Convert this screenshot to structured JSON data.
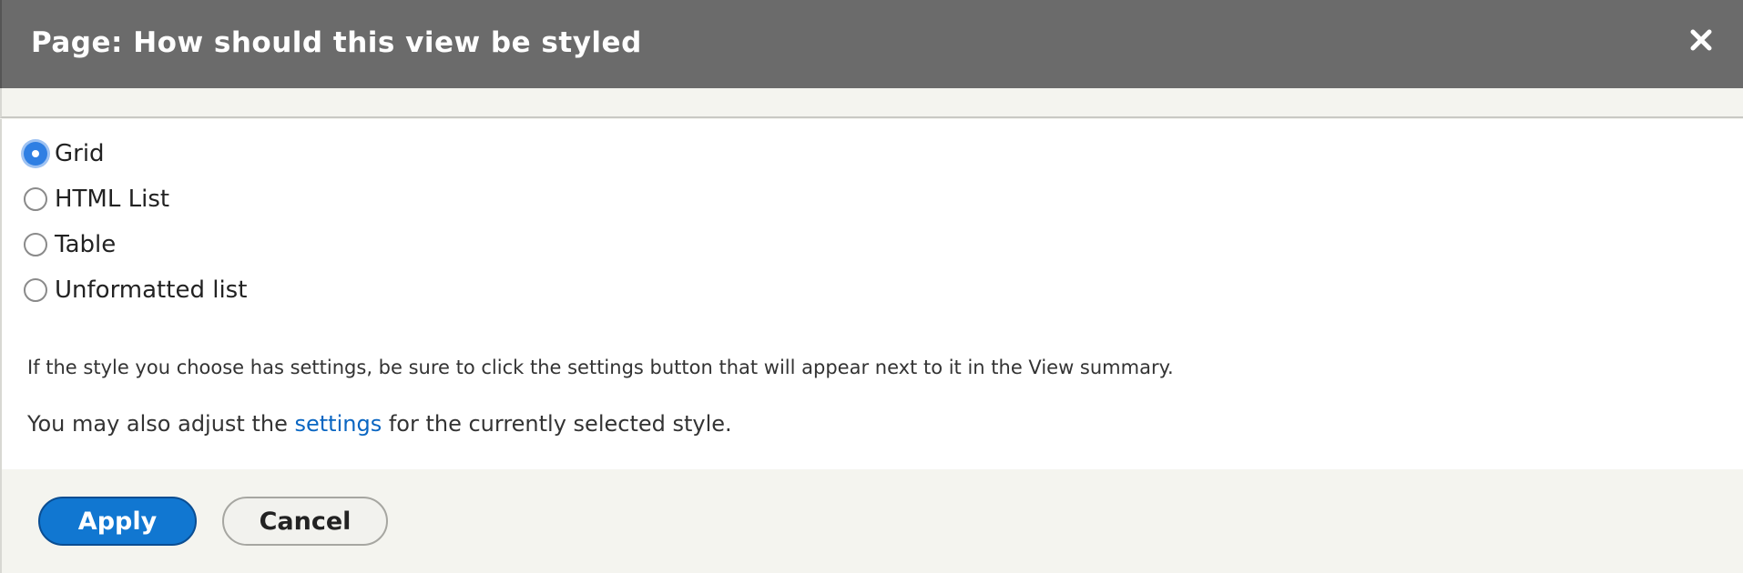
{
  "dialog": {
    "title": "Page: How should this view be styled",
    "close_icon": "close-icon"
  },
  "style_options": {
    "selected": "Grid",
    "items": [
      {
        "label": "Grid",
        "checked": true
      },
      {
        "label": "HTML List",
        "checked": false
      },
      {
        "label": "Table",
        "checked": false
      },
      {
        "label": "Unformatted list",
        "checked": false
      }
    ]
  },
  "help_text": "If the style you choose has settings, be sure to click the settings button that will appear next to it in the View summary.",
  "adjust": {
    "prefix": "You may also adjust the ",
    "link": "settings",
    "suffix": " for the currently selected style."
  },
  "buttons": {
    "apply": "Apply",
    "cancel": "Cancel"
  },
  "colors": {
    "titlebar": "#6b6b6b",
    "primary": "#1177d1",
    "link": "#0a66c2",
    "radio_checked": "#2f7fe3"
  }
}
